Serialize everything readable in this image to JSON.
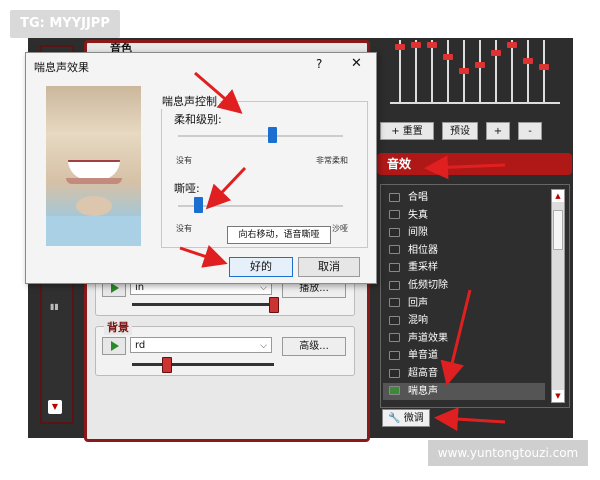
{
  "watermarks": {
    "top": "TG: MYYJJPP",
    "bottom": "www.yuntongtouzi.com"
  },
  "background_app": {
    "section_title": "音色",
    "group1": {
      "combo_value": "in",
      "advanced_label": "播放..."
    },
    "background_group": {
      "title": "背景",
      "combo_value": "rd",
      "advanced_label": "高级..."
    },
    "eq_buttons": {
      "reset": "+ 重置",
      "preset": "预设",
      "plus": "+",
      "minus": "-"
    },
    "effects": {
      "header": "音效",
      "items": [
        {
          "label": "合唱"
        },
        {
          "label": "失真"
        },
        {
          "label": "间隙"
        },
        {
          "label": "相位器"
        },
        {
          "label": "重采样"
        },
        {
          "label": "低频切除"
        },
        {
          "label": "回声"
        },
        {
          "label": "混响"
        },
        {
          "label": "声道效果"
        },
        {
          "label": "单音道"
        },
        {
          "label": "超高音"
        },
        {
          "label": "喘息声"
        }
      ],
      "selected_index": 11,
      "fine_tune_button": "微调"
    }
  },
  "dialog": {
    "title": "喘息声效果",
    "help": "?",
    "close": "✕",
    "group_title": "喘息声控制",
    "softness": {
      "label": "柔和级别:",
      "min_label": "没有",
      "max_label": "非常柔和",
      "value_fraction": 0.57
    },
    "hoarse": {
      "label": "嘶哑:",
      "min_label": "没有",
      "max_label": "沙哑",
      "value_fraction": 0.12
    },
    "tooltip": "向右移动，语音嘶哑",
    "ok_button": "好的",
    "cancel_button": "取消"
  },
  "colors": {
    "accent_red": "#b01818",
    "slider_blue": "#1a6fd0",
    "annotation_red": "#e02020"
  }
}
